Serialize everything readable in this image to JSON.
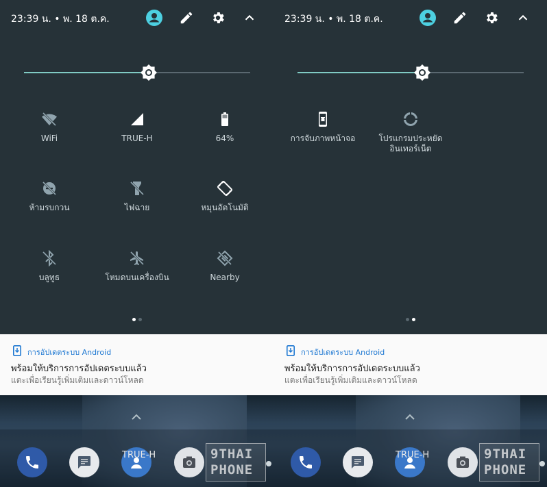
{
  "colors": {
    "panel_bg": "#263238",
    "accent_teal": "#4dd0e1",
    "slider_fill": "#80cbc4",
    "notif_app": "#1e78d2",
    "tile_on": "#cfd8dc"
  },
  "panels": [
    {
      "status": {
        "time": "23:39 น. • พ. 18 ต.ค.",
        "icons": [
          "account-icon",
          "edit-pencil-icon",
          "settings-gear-icon",
          "chevron-up-icon"
        ]
      },
      "brightness": {
        "level": 0.55
      },
      "tiles": [
        {
          "label": "WiFi",
          "icon": "wifi-off-icon",
          "state": "off"
        },
        {
          "label": "TRUE-H",
          "icon": "cellular-signal-icon",
          "state": "on"
        },
        {
          "label": "64%",
          "icon": "battery-icon",
          "state": "on"
        },
        {
          "label": "ห้ามรบกวน",
          "icon": "do-not-disturb-off-icon",
          "state": "off"
        },
        {
          "label": "ไฟฉาย",
          "icon": "flashlight-off-icon",
          "state": "off"
        },
        {
          "label": "หมุนอัตโนมัติ",
          "icon": "auto-rotate-icon",
          "state": "on"
        },
        {
          "label": "บลูทูธ",
          "icon": "bluetooth-off-icon",
          "state": "off"
        },
        {
          "label": "โหมดบนเครื่องบิน",
          "icon": "airplane-off-icon",
          "state": "off"
        },
        {
          "label": "Nearby",
          "icon": "nearby-off-icon",
          "state": "off"
        }
      ],
      "page_index": 0,
      "page_count": 2,
      "notification": {
        "app": "การอัปเดตระบบ Android",
        "title": "พร้อมให้บริการการอัปเดตระบบแล้ว",
        "text": "แตะเพื่อเรียนรู้เพิ่มเติมและดาวน์โหลด"
      },
      "home": {
        "dock_label": "TRUE-H",
        "watermark": [
          "9THAI",
          "PHONE"
        ]
      }
    },
    {
      "status": {
        "time": "23:39 น. • พ. 18 ต.ค.",
        "icons": [
          "account-icon",
          "edit-pencil-icon",
          "settings-gear-icon",
          "chevron-up-icon"
        ]
      },
      "brightness": {
        "level": 0.55
      },
      "tiles": [
        {
          "label": "การจับภาพหน้าจอ",
          "icon": "screenshot-phone-icon",
          "state": "on"
        },
        {
          "label": "โปรแกรมประหยัด\nอินเทอร์เน็ต",
          "icon": "data-saver-icon",
          "state": "off"
        }
      ],
      "page_index": 1,
      "page_count": 2,
      "notification": {
        "app": "การอัปเดตระบบ Android",
        "title": "พร้อมให้บริการการอัปเดตระบบแล้ว",
        "text": "แตะเพื่อเรียนรู้เพิ่มเติมและดาวน์โหลด"
      },
      "home": {
        "dock_label": "TRUE-H",
        "watermark": [
          "9THAI",
          "PHONE"
        ]
      }
    }
  ]
}
